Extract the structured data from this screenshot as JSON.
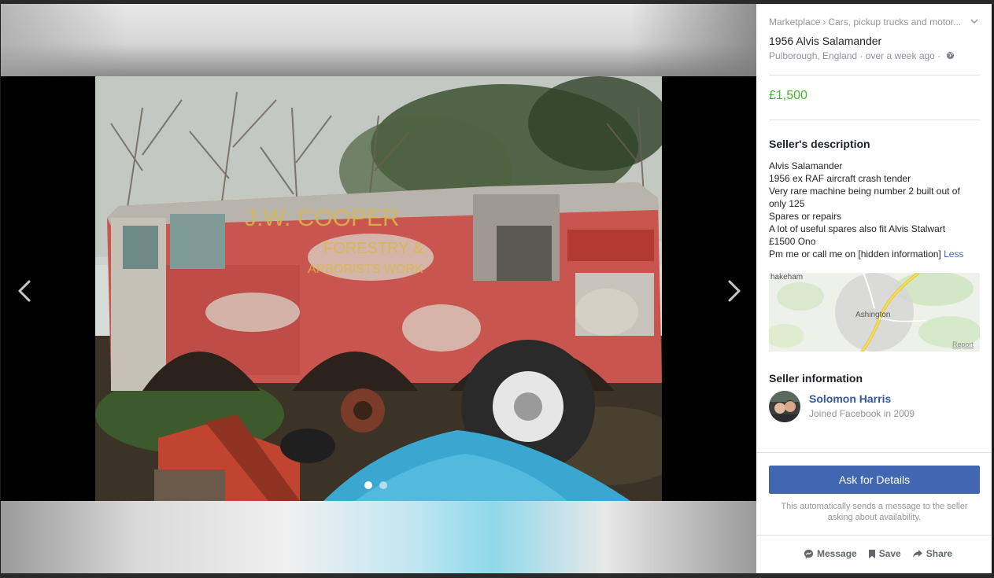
{
  "breadcrumb": {
    "items": [
      "Marketplace",
      "Cars, pickup trucks and motor..."
    ],
    "separator": "›"
  },
  "listing": {
    "title": "1956 Alvis Salamander",
    "location": "Pulborough, England",
    "time": "over a week ago",
    "dot": "·",
    "price": "£1,500"
  },
  "description": {
    "heading": "Seller's description",
    "lines": [
      "Alvis Salamander",
      "1956 ex RAF aircraft crash tender",
      "Very rare machine being number 2 built out of only 125",
      "Spares or repairs",
      "A lot of useful spares also fit Alvis Stalwart",
      "£1500 Ono",
      "Pm me or call me on [hidden information]"
    ],
    "less_link": "Less"
  },
  "map": {
    "labels": [
      "hakeham",
      "Ashington"
    ],
    "report": "Report"
  },
  "seller": {
    "heading": "Seller information",
    "name": "Solomon Harris",
    "joined": "Joined Facebook in 2009"
  },
  "cta": {
    "ask_label": "Ask for Details",
    "note": "This automatically sends a message to the seller asking about availability."
  },
  "actions": {
    "message": "Message",
    "save": "Save",
    "share": "Share"
  },
  "photo": {
    "sign_lines": [
      "J.W. COOPER",
      "FORESTRY &",
      "ARBORISTS WORK"
    ],
    "slide_count": 2,
    "active_slide": 1
  },
  "colors": {
    "price": "#42b72a",
    "link": "#365899",
    "button": "#4267b2"
  }
}
